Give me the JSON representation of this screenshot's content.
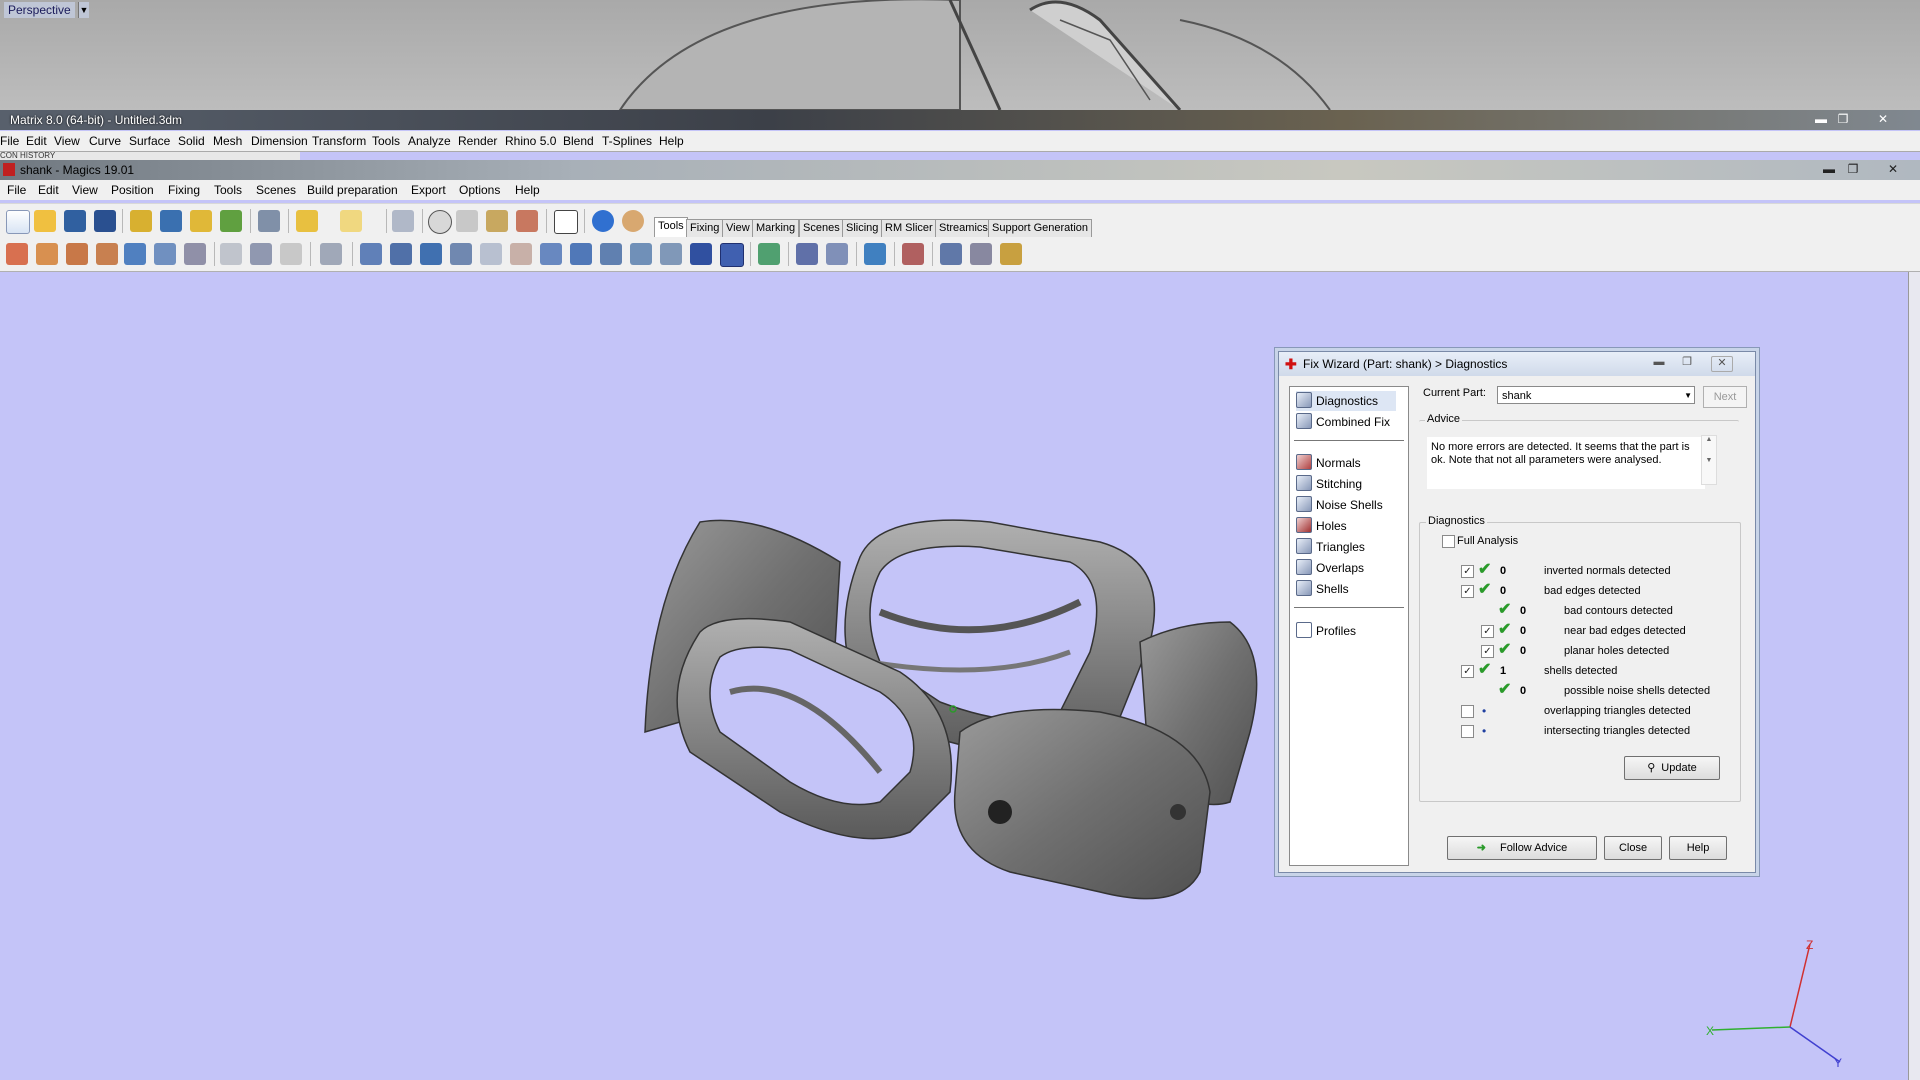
{
  "rhino": {
    "viewport_label": "Perspective",
    "viewport_dropdown": "▼",
    "title": "Matrix 8.0 (64-bit) - Untitled.3dm",
    "menu": [
      "File",
      "Edit",
      "View",
      "Curve",
      "Surface",
      "Solid",
      "Mesh",
      "Dimension",
      "Transform",
      "Tools",
      "Analyze",
      "Render",
      "Rhino 5.0",
      "Blend",
      "T-Splines",
      "Help"
    ],
    "history_label": "CON HISTORY"
  },
  "magics": {
    "title": "shank - Magics 19.01",
    "menu": [
      "File",
      "Edit",
      "View",
      "Position",
      "Fixing",
      "Tools",
      "Scenes",
      "Build preparation",
      "Export",
      "Options",
      "Help"
    ],
    "tabs": [
      "Tools",
      "Fixing",
      "View",
      "Marking",
      "Scenes",
      "Slicing",
      "RM Slicer",
      "Streamics",
      "Support Generation"
    ],
    "active_tab": "Tools"
  },
  "window_controls": {
    "minimize": "▬",
    "maximize": "❐",
    "close": "✕"
  },
  "fix_wizard": {
    "title": "Fix Wizard (Part: shank) > Diagnostics",
    "nav": {
      "diagnostics": "Diagnostics",
      "combined_fix": "Combined Fix",
      "normals": "Normals",
      "stitching": "Stitching",
      "noise_shells": "Noise Shells",
      "holes": "Holes",
      "triangles": "Triangles",
      "overlaps": "Overlaps",
      "shells": "Shells",
      "profiles": "Profiles"
    },
    "current_part_label": "Current Part:",
    "current_part_value": "shank",
    "next_label": "Next",
    "advice_title": "Advice",
    "advice_text": "No more errors are detected. It seems that the part is ok. Note that not all parameters were analysed.",
    "diagnostics_title": "Diagnostics",
    "full_analysis_label": "Full Analysis",
    "rows": [
      {
        "count": "0",
        "label": "inverted normals detected"
      },
      {
        "count": "0",
        "label": "bad edges detected"
      },
      {
        "count": "0",
        "label": "bad contours detected"
      },
      {
        "count": "0",
        "label": "near bad edges detected"
      },
      {
        "count": "0",
        "label": "planar holes detected"
      },
      {
        "count": "1",
        "label": "shells detected"
      },
      {
        "count": "0",
        "label": "possible noise shells detected"
      },
      {
        "count": "",
        "label": "overlapping triangles detected"
      },
      {
        "count": "",
        "label": "intersecting triangles detected"
      }
    ],
    "update_label": "Update",
    "follow_advice_label": "Follow Advice",
    "close_label": "Close",
    "help_label": "Help"
  },
  "axes": {
    "x": "X",
    "y": "Y",
    "z": "Z"
  },
  "colors": {
    "viewport_bg": "#c4c4f8",
    "check_green": "#2a9a2a",
    "wizard_cross": "#d01010"
  }
}
